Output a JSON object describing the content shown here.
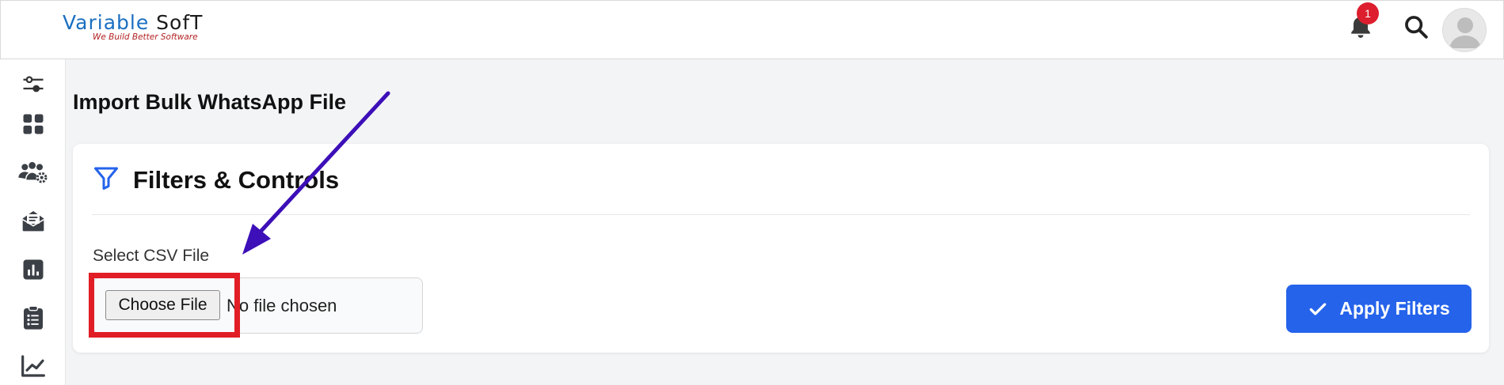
{
  "header": {
    "logo_main_blue": "Variable",
    "logo_main_dark": " SofT",
    "logo_tagline": "We Build Better Software",
    "notification_count": "1"
  },
  "sidebar": {
    "items": [
      {
        "icon": "sliders-icon"
      },
      {
        "icon": "dashboard-grid-icon"
      },
      {
        "icon": "users-settings-icon"
      },
      {
        "icon": "message-inbox-icon"
      },
      {
        "icon": "bar-chart-icon"
      },
      {
        "icon": "clipboard-list-icon"
      },
      {
        "icon": "line-chart-icon"
      }
    ]
  },
  "page": {
    "title": "Import Bulk WhatsApp File"
  },
  "filters": {
    "title": "Filters & Controls",
    "csv_label": "Select CSV File",
    "choose_file_label": "Choose File",
    "no_file_text": "No file chosen",
    "apply_label": "Apply Filters"
  },
  "colors": {
    "primary": "#2563eb",
    "highlight": "#e11d25",
    "arrow": "#3c0fb8",
    "badge": "#dc1e2e"
  }
}
